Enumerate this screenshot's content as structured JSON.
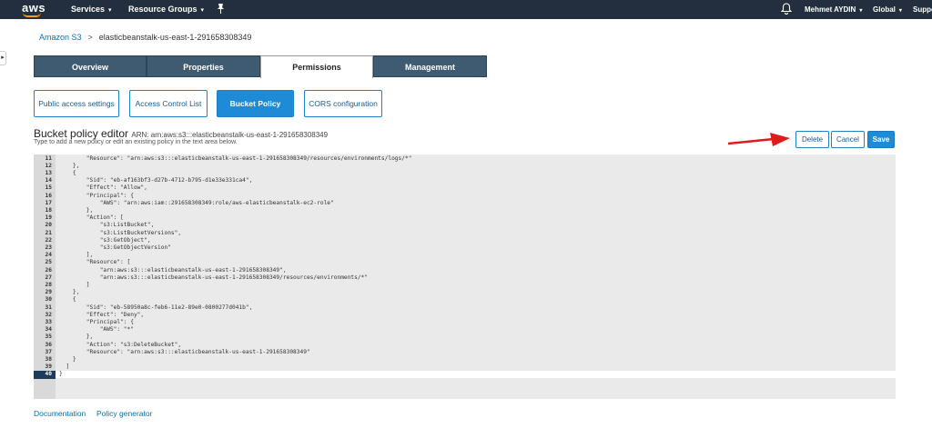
{
  "topnav": {
    "logo": "aws",
    "services": "Services",
    "resource_groups": "Resource Groups",
    "chevron": "▾",
    "user": "Mehmet AYDIN",
    "region": "Global",
    "support": "Suppo",
    "icons": [
      "pin-icon",
      "bell-icon"
    ],
    "background_color": "#232f3e"
  },
  "breadcrumb": {
    "root": "Amazon S3",
    "separator": ">",
    "current": "elasticbeanstalk-us-east-1-291658308349"
  },
  "tabs": [
    "Overview",
    "Properties",
    "Permissions",
    "Management"
  ],
  "active_tab": "Permissions",
  "subtabs": [
    "Public access settings",
    "Access Control List",
    "Bucket Policy",
    "CORS configuration"
  ],
  "active_subtab": "Bucket Policy",
  "editor": {
    "title": "Bucket policy editor",
    "arn": "ARN: arn:aws:s3:::elasticbeanstalk-us-east-1-291658308349",
    "hint": "Type to add a new policy or edit an existing policy in the text area below.",
    "lines": [
      {
        "n": "11",
        "text": "        \"Resource\": \"arn:aws:s3:::elasticbeanstalk-us-east-1-291658308349/resources/environments/logs/*\""
      },
      {
        "n": "12",
        "text": "    },"
      },
      {
        "n": "13",
        "text": "    {"
      },
      {
        "n": "14",
        "text": "        \"Sid\": \"eb-af163bf3-d27b-4712-b795-d1e33e331ca4\","
      },
      {
        "n": "15",
        "text": "        \"Effect\": \"Allow\","
      },
      {
        "n": "16",
        "text": "        \"Principal\": {"
      },
      {
        "n": "17",
        "text": "            \"AWS\": \"arn:aws:iam::291658308349:role/aws-elasticbeanstalk-ec2-role\""
      },
      {
        "n": "18",
        "text": "        },"
      },
      {
        "n": "19",
        "text": "        \"Action\": ["
      },
      {
        "n": "20",
        "text": "            \"s3:ListBucket\","
      },
      {
        "n": "21",
        "text": "            \"s3:ListBucketVersions\","
      },
      {
        "n": "22",
        "text": "            \"s3:GetObject\","
      },
      {
        "n": "23",
        "text": "            \"s3:GetObjectVersion\""
      },
      {
        "n": "24",
        "text": "        ],"
      },
      {
        "n": "25",
        "text": "        \"Resource\": ["
      },
      {
        "n": "26",
        "text": "            \"arn:aws:s3:::elasticbeanstalk-us-east-1-291658308349\","
      },
      {
        "n": "27",
        "text": "            \"arn:aws:s3:::elasticbeanstalk-us-east-1-291658308349/resources/environments/*\""
      },
      {
        "n": "28",
        "text": "        ]"
      },
      {
        "n": "29",
        "text": "    },"
      },
      {
        "n": "30",
        "text": "    {"
      },
      {
        "n": "31",
        "text": "        \"Sid\": \"eb-58950a8c-feb6-11e2-89e0-0800277d041b\","
      },
      {
        "n": "32",
        "text": "        \"Effect\": \"Deny\","
      },
      {
        "n": "33",
        "text": "        \"Principal\": {"
      },
      {
        "n": "34",
        "text": "            \"AWS\": \"*\""
      },
      {
        "n": "35",
        "text": "        },"
      },
      {
        "n": "36",
        "text": "        \"Action\": \"s3:DeleteBucket\","
      },
      {
        "n": "37",
        "text": "        \"Resource\": \"arn:aws:s3:::elasticbeanstalk-us-east-1-291658308349\""
      },
      {
        "n": "38",
        "text": "    }"
      },
      {
        "n": "39",
        "text": "  ]"
      },
      {
        "n": "40",
        "text": "}"
      }
    ],
    "current_line": "40"
  },
  "buttons": {
    "delete": "Delete",
    "cancel": "Cancel",
    "save": "Save"
  },
  "footer": {
    "documentation": "Documentation",
    "policy_generator": "Policy generator"
  },
  "colors": {
    "accent": "#1f8ad6",
    "tab_inactive": "#3f5b72",
    "link": "#0073bb",
    "arrow": "#e01b1b",
    "brand_orange": "#ff9900"
  }
}
